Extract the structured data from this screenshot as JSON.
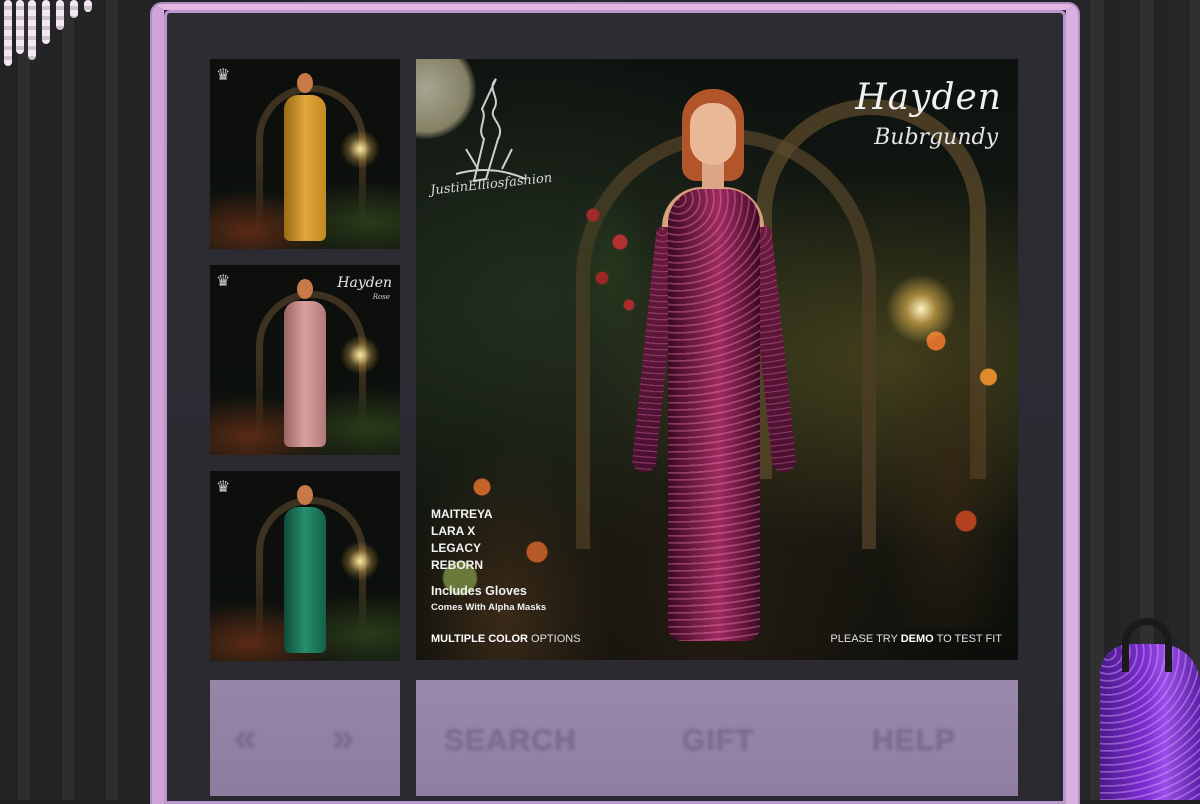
{
  "scene": {
    "board_frame_color": "#d9b0e0",
    "panel_color": "#9886a8"
  },
  "thumbnails": [
    {
      "title": "",
      "subtitle": "",
      "dress_color": "#d9a02a",
      "fine_print": ""
    },
    {
      "title": "Hayden",
      "subtitle": "Rose",
      "dress_color": "#c98e8e",
      "fine_print": ""
    },
    {
      "title": "",
      "subtitle": "",
      "dress_color": "#1f7a5e",
      "fine_print": ""
    }
  ],
  "main_ad": {
    "logo_text": "JustinElliosfashion",
    "title": "Hayden",
    "subtitle": "Bubrgundy",
    "bodies": [
      "MAITREYA",
      "LARA X",
      "LEGACY",
      "REBORN"
    ],
    "gloves": "Includes Gloves",
    "masks": "Comes With Alpha Masks",
    "footer_left_strong": "MULTIPLE COLOR",
    "footer_left_rest": " OPTIONS",
    "footer_right_pre": "PLEASE TRY ",
    "footer_right_strong": "DEMO",
    "footer_right_post": " TO TEST FIT",
    "dress_color": "#8a2452"
  },
  "navigation": {
    "prev_label": "«",
    "next_label": "»"
  },
  "commands": {
    "search_label": "SEARCH",
    "gift_label": "GIFT",
    "help_label": "HELP"
  },
  "display_dress": {
    "color": "#7a2ed0"
  }
}
